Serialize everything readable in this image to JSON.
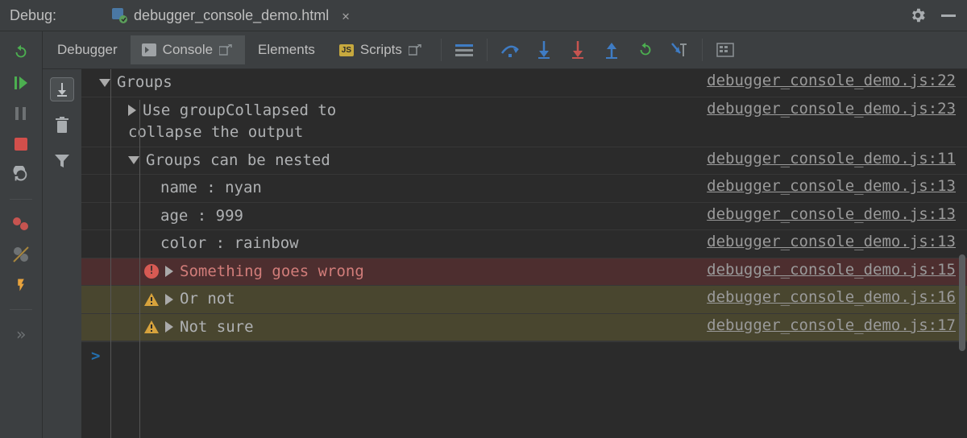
{
  "header": {
    "title": "Debug:",
    "tab_file": "debugger_console_demo.html"
  },
  "tabs": {
    "debugger": "Debugger",
    "console": "Console",
    "elements": "Elements",
    "scripts": "Scripts"
  },
  "log": {
    "r0": {
      "text": "Groups",
      "src": "debugger_console_demo.js:22"
    },
    "r1": {
      "text": "Use groupCollapsed to collapse the output",
      "src": "debugger_console_demo.js:23"
    },
    "r2": {
      "text": "Groups can be nested",
      "src": "debugger_console_demo.js:11"
    },
    "r3": {
      "text": "name :  nyan",
      "src": "debugger_console_demo.js:13"
    },
    "r4": {
      "text": "age :  999",
      "src": "debugger_console_demo.js:13"
    },
    "r5": {
      "text": "color :  rainbow",
      "src": "debugger_console_demo.js:13"
    },
    "r6": {
      "text": "Something goes wrong",
      "src": "debugger_console_demo.js:15"
    },
    "r7": {
      "text": "Or not",
      "src": "debugger_console_demo.js:16"
    },
    "r8": {
      "text": "Not sure",
      "src": "debugger_console_demo.js:17"
    }
  },
  "prompt": ">"
}
